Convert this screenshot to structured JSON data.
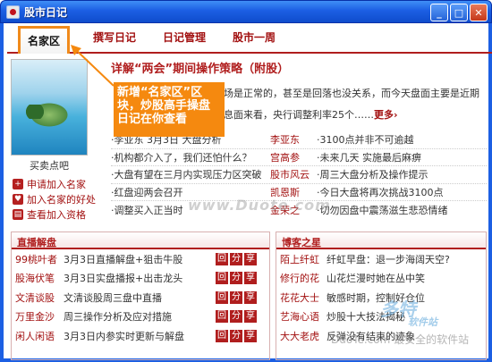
{
  "window": {
    "title": "股市日记",
    "minimize": "_",
    "maximize": "□",
    "close": "✕"
  },
  "tabs": [
    "名家区",
    "撰写日记",
    "日记管理",
    "股市一周"
  ],
  "profile": {
    "caption": "买卖点吧"
  },
  "left_actions": [
    {
      "icon": "+",
      "label": "申请加入名家"
    },
    {
      "icon": "♥",
      "label": "加入名家的好处"
    },
    {
      "icon": "▤",
      "label": "查看加入资格"
    }
  ],
  "headline": "详解“两会”期间操作策略（附股）",
  "intro": [
    "场是正常的，甚至是回落也没关系，而今天盘面主要是近期",
    "息面来看，央行调整利率25个……"
  ],
  "more": "更多",
  "callout": "新增“名家区”区\n块，炒股高手操盘\n日记在你查看",
  "news": [
    {
      "left": "·李亚东  3月3日  大盘分析",
      "author": "李亚东",
      "right": "·3100点并非不可逾越"
    },
    {
      "left": "·机构都介入了，我们还怕什么？",
      "author": "宫高参",
      "right": "·未来几天  实施最后麻痹"
    },
    {
      "left": "·大盘有望在三月内实现压力区突破",
      "author": "股市风云",
      "right": "·周三大盘分析及操作提示"
    },
    {
      "left": "·红盘迎两会召开",
      "author": "凯恩斯",
      "right": "·今日大盘将再次挑战3100点"
    },
    {
      "left": "·调整买入正当时",
      "author": "金荣之",
      "right": "·切勿因盘中震荡滋生悲恐情绪"
    }
  ],
  "panel_live": {
    "title": "直播解盘",
    "rows": [
      {
        "author": "99桃叶者",
        "text": "3月3日直播解盘+狙击牛股",
        "tags": [
          "回",
          "分",
          "享"
        ]
      },
      {
        "author": "股海伏笔",
        "text": "3月3日实盘播报+出击龙头",
        "tags": [
          "回",
          "分",
          "享"
        ]
      },
      {
        "author": "文清谈股",
        "text": "文清谈股周三盘中直播",
        "tags": [
          "回",
          "分",
          "享"
        ]
      },
      {
        "author": "万里金沙",
        "text": "周三操作分析及应对措施",
        "tags": [
          "回",
          "分",
          "享"
        ]
      },
      {
        "author": "闲人闲语",
        "text": "3月3日内参实时更新与解盘",
        "tags": [
          "回",
          "分",
          "享"
        ]
      }
    ]
  },
  "panel_blog": {
    "title": "博客之星",
    "rows": [
      {
        "author": "陌上纤虹",
        "text": "纤虹早盘：退一步海阔天空?"
      },
      {
        "author": "修行的花",
        "text": "山花烂漫时她在丛中笑"
      },
      {
        "author": "花花大士",
        "text": "敏感时期，控制好仓位"
      },
      {
        "author": "艺海心语",
        "text": "炒股十大技法揭秘"
      },
      {
        "author": "大大老虎",
        "text": "反弹没有结束的迹象"
      }
    ]
  },
  "watermarks": {
    "center": "www.Duote.com",
    "logo": "多特",
    "logo_sub": "软件站",
    "site": "DuoTe.com",
    "slogan": "最安全的软件站"
  }
}
